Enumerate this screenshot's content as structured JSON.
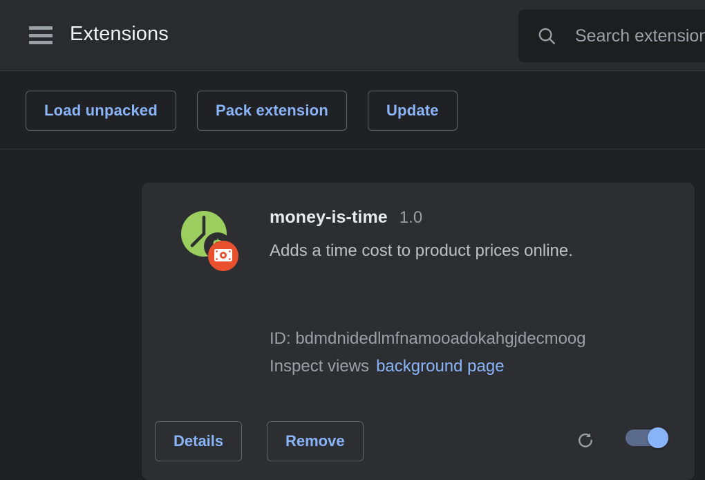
{
  "header": {
    "menu_icon": "hamburger-menu-icon",
    "title": "Extensions",
    "search": {
      "icon": "search-icon",
      "placeholder": "Search extensions",
      "value": ""
    }
  },
  "toolbar": {
    "buttons": [
      {
        "label": "Load unpacked",
        "name": "load-unpacked-button"
      },
      {
        "label": "Pack extension",
        "name": "pack-extension-button"
      },
      {
        "label": "Update",
        "name": "update-button"
      }
    ]
  },
  "extension": {
    "icon": "money-is-time-clock-icon",
    "badge_icon": "banknote-badge-icon",
    "name": "money-is-time",
    "version": "1.0",
    "description": "Adds a time cost to product prices online.",
    "id_label": "ID: bdmdnidedlmfnamooadokahgjdecmoog",
    "inspect_views_label": "Inspect views",
    "inspect_views_link": "background page",
    "details_label": "Details",
    "remove_label": "Remove",
    "reload_icon": "reload-icon",
    "enabled_toggle": "on"
  },
  "colors": {
    "page_background": "#202124",
    "header_background": "#292b2e",
    "card_background": "#2c2e31",
    "accent_link": "#8ab4f8",
    "border": "#5f6368",
    "text_primary": "#e8eaed",
    "text_secondary": "#9aa0a6",
    "icon_green": "#9bce5f",
    "badge_orange": "#e8502e",
    "toggle_track": "#5a6b8c",
    "toggle_knob": "#8ab4f8"
  }
}
